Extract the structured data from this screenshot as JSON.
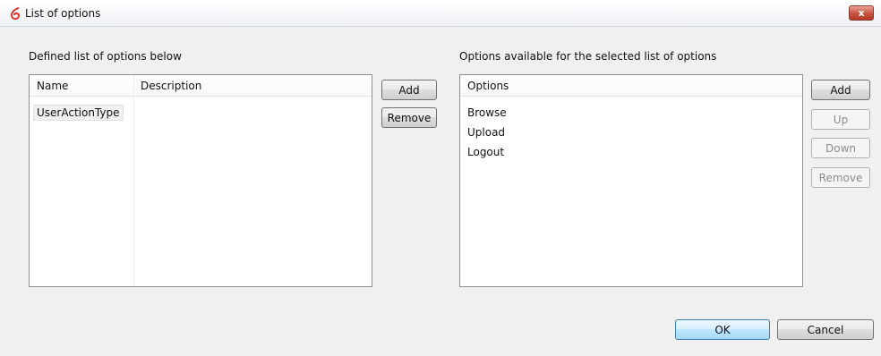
{
  "window": {
    "title": "List of options",
    "close_glyph": "x",
    "icon": "app-logo-icon"
  },
  "left_panel": {
    "label": "Defined list of options below",
    "columns": [
      "Name",
      "Description"
    ],
    "rows": [
      {
        "name": "UserActionType",
        "description": ""
      }
    ],
    "buttons": {
      "add": "Add",
      "remove": "Remove"
    }
  },
  "right_panel": {
    "label": "Options available for the selected list of options",
    "column": "Options",
    "items": [
      "Browse",
      "Upload",
      "Logout"
    ],
    "buttons": {
      "add": "Add",
      "up": "Up",
      "down": "Down",
      "remove": "Remove"
    }
  },
  "footer": {
    "ok": "OK",
    "cancel": "Cancel"
  },
  "colors": {
    "logo": "#e0352b",
    "close_button": "#c8533f",
    "default_button_border": "#3c7fb1"
  }
}
